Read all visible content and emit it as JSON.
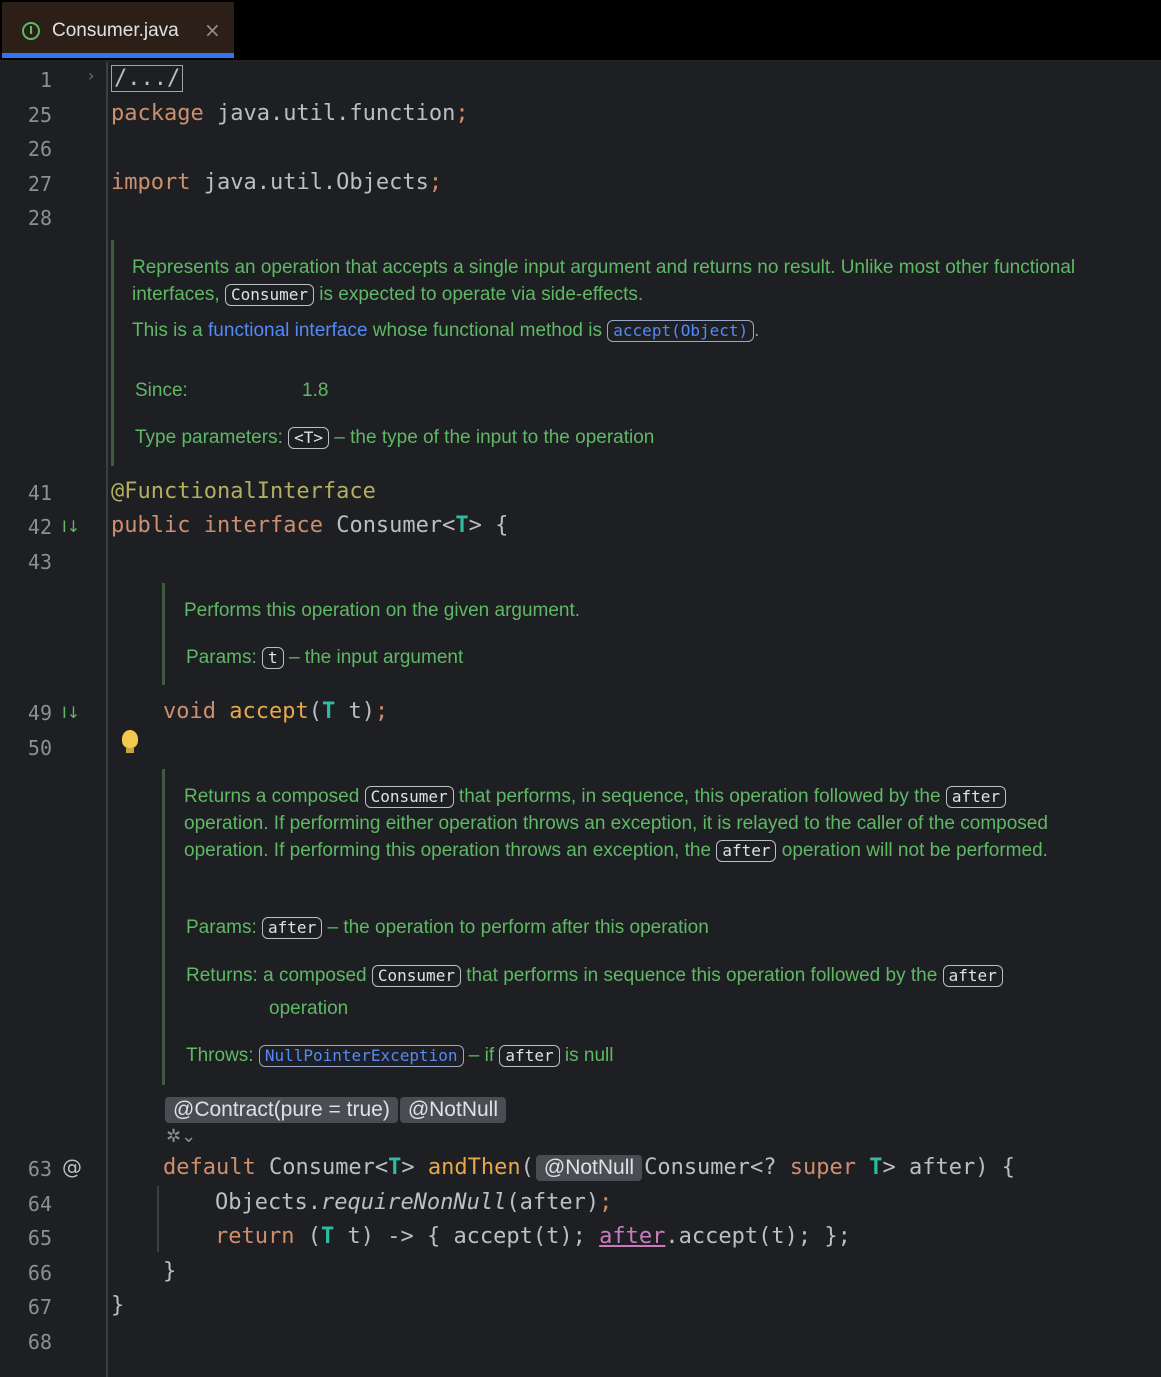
{
  "tab": {
    "title": "Consumer.java",
    "icon": "interface-icon",
    "close": "×"
  },
  "lines": {
    "l1": "1",
    "l25": "25",
    "l26": "26",
    "l27": "27",
    "l28": "28",
    "l41": "41",
    "l42": "42",
    "l43": "43",
    "l49": "49",
    "l50": "50",
    "l63": "63",
    "l64": "64",
    "l65": "65",
    "l66": "66",
    "l67": "67",
    "l68": "68"
  },
  "gutter_icons": {
    "implemented": "I↓",
    "annotation": "@"
  },
  "code": {
    "fold": "/.../",
    "package_kw": "package",
    "package_name": " java.util.function",
    "semi": ";",
    "import_kw": "import",
    "import_name": " java.util.Objects",
    "annotation": "@FunctionalInterface",
    "public_kw": "public",
    "interface_kw": "interface",
    "iface_name": " Consumer<",
    "T": "T",
    "iface_rest": "> {",
    "void_kw": "void",
    "accept_fn": "accept",
    "accept_rest_open": "(",
    "accept_param": " t)",
    "contract_inlay": "@Contract(pure = true)",
    "notnull_inlay": "@NotNull",
    "default_kw": "default",
    "ret_type": " Consumer<",
    "ret_type_close": "> ",
    "andthen_fn": "andThen",
    "paren_open": "(",
    "param_type": "Consumer<? ",
    "super_kw": "super",
    "param_rest": "> after) {",
    "objects": "Objects.",
    "require_fn": "requireNonNull",
    "require_args": "(after)",
    "return_kw": "return",
    "lambda_a": " (",
    "lambda_b": " t) -> { accept(t);",
    "after_ref": "after",
    "lambda_c": ".accept(t);",
    "lambda_d": " };",
    "close_method": "}",
    "close_class": "}"
  },
  "doc1": {
    "text_a": "Represents an operation that accepts a single input argument and returns no result. Unlike most other functional interfaces, ",
    "consumer": "Consumer",
    "text_b": " is expected to operate via side-effects.",
    "text_c": "This is a ",
    "fi_link": "functional interface",
    "text_d": " whose functional method is ",
    "accept_link": "accept(Object)",
    "text_e": ".",
    "since_label": "Since:",
    "since_value": "1.8",
    "tparams_label": "Type parameters:",
    "tparam": "<T>",
    "tparam_desc": " – the type of the input to the operation"
  },
  "doc2": {
    "text": "Performs this operation on the given argument.",
    "params_label": "Params:",
    "param": "t",
    "param_desc": " – the input argument"
  },
  "doc3": {
    "text_a": "Returns a composed ",
    "consumer": "Consumer",
    "text_b": " that performs, in sequence, this operation followed by the ",
    "after": "after",
    "text_c": " operation. If performing either operation throws an exception, it is relayed to the caller of the composed operation. If performing this operation throws an exception, the ",
    "text_d": " operation will not be performed.",
    "params_label": "Params:",
    "param_desc": " – the operation to perform after this operation",
    "returns_label": "Returns:",
    "returns_a": "a composed ",
    "returns_b": " that performs in sequence this operation followed by the ",
    "returns_c": "operation",
    "throws_label": "Throws:",
    "npe": "NullPointerException",
    "throws_a": " – if ",
    "throws_b": " is null"
  }
}
